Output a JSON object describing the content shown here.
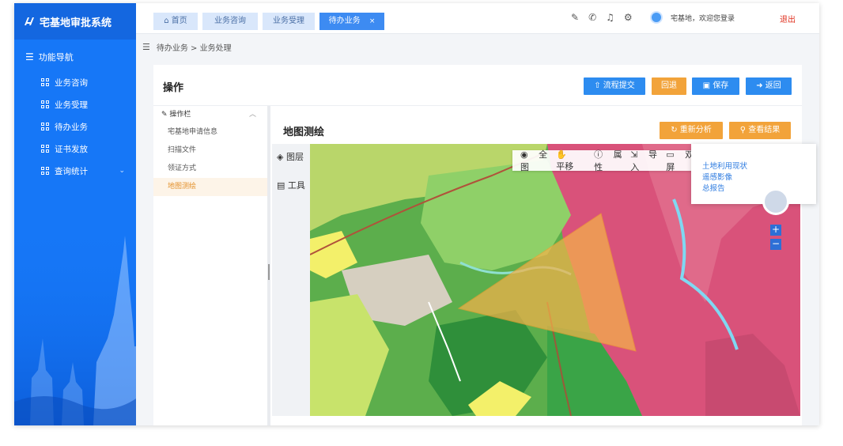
{
  "brand": {
    "title": "宅基地审批系统"
  },
  "sidebar": {
    "nav_title": "功能导航",
    "items": [
      {
        "label": "业务咨询"
      },
      {
        "label": "业务受理"
      },
      {
        "label": "待办业务"
      },
      {
        "label": "证书发放"
      },
      {
        "label": "查询统计"
      }
    ]
  },
  "tabs": [
    {
      "label": "首页",
      "icon": "home-icon"
    },
    {
      "label": "业务咨询"
    },
    {
      "label": "业务受理"
    },
    {
      "label": "待办业务",
      "close": "×"
    }
  ],
  "header": {
    "welcome": "宅基地，欢迎您登录",
    "logout": "退出"
  },
  "breadcrumb": "待办业务 > 业务处理",
  "operation": {
    "title": "操作",
    "buttons": {
      "submit": "流程提交",
      "rollback": "回退",
      "save": "保存",
      "back": "返回"
    }
  },
  "left_menu": {
    "header": "操作栏",
    "items": [
      {
        "label": "宅基地申请信息"
      },
      {
        "label": "扫描文件"
      },
      {
        "label": "领证方式"
      },
      {
        "label": "地图测绘"
      }
    ]
  },
  "map": {
    "title": "地图测绘",
    "buttons": {
      "reanalyze": "重新分析",
      "view_result": "查看结果"
    },
    "side": {
      "layers": "图层",
      "tools": "工具"
    },
    "toolbar": [
      "全图",
      "平移",
      "属性",
      "导入",
      "双屏"
    ],
    "dropdown": [
      "土地利用现状",
      "遥感影像",
      "总报告"
    ]
  },
  "colors": {
    "sidebar": "#1677f7",
    "primary": "#2d8cf0",
    "orange": "#f2a33a",
    "logout": "#e0301e",
    "active_menu": "#e4922e"
  }
}
